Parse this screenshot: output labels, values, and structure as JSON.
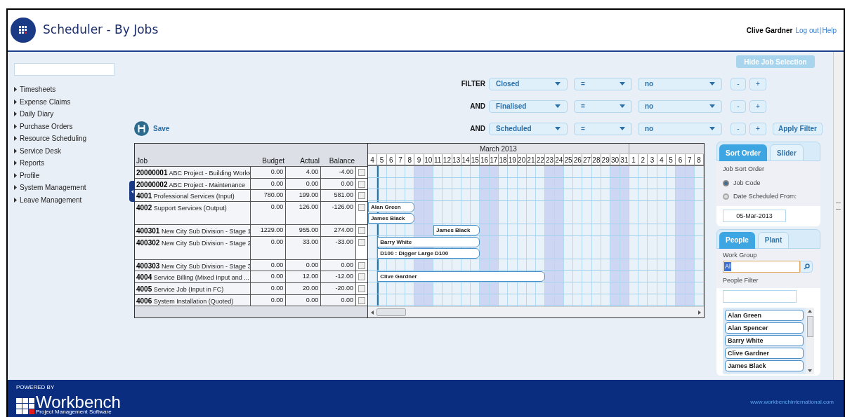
{
  "header": {
    "title": "Scheduler - By Jobs",
    "user": "Clive Gardner",
    "links": [
      "Log out",
      "Help"
    ],
    "link_separator": "|"
  },
  "sidebar": {
    "items": [
      "Timesheets",
      "Expense Claims",
      "Daily Diary",
      "Purchase Orders",
      "Resource Scheduling",
      "Service Desk",
      "Reports",
      "Profile",
      "System Management",
      "Leave Management"
    ]
  },
  "hide_button": "Hide Job Selection",
  "save_button": "Save",
  "filters": [
    {
      "conjunction": "FILTER",
      "field": "Closed",
      "operator": "=",
      "value": "no",
      "remove": "-",
      "add": "+"
    },
    {
      "conjunction": "AND",
      "field": "Finalised",
      "operator": "=",
      "value": "no",
      "remove": "-",
      "add": "+"
    },
    {
      "conjunction": "AND",
      "field": "Scheduled",
      "operator": "=",
      "value": "no",
      "remove": "-",
      "add": "+"
    }
  ],
  "apply_button": "Apply Filter",
  "table": {
    "columns": [
      "Job",
      "Budget",
      "Actual",
      "Balance"
    ],
    "rows": [
      {
        "code": "20000001",
        "name": "ABC Project - Building Works",
        "budget": "0.00",
        "actual": "4.00",
        "balance": "-4.00",
        "checked": false,
        "bars": []
      },
      {
        "code": "20000002",
        "name": "ABC Project - Maintenance",
        "budget": "0.00",
        "actual": "0.00",
        "balance": "0.00",
        "checked": false,
        "bars": []
      },
      {
        "code": "4001",
        "name": "Professional Services (Input)",
        "budget": "780.00",
        "actual": "199.00",
        "balance": "581.00",
        "checked": false,
        "bars": []
      },
      {
        "code": "4002",
        "name": "Support Services (Output)",
        "budget": "0.00",
        "actual": "126.00",
        "balance": "-126.00",
        "checked": false,
        "bars": [
          {
            "label": "Alan Green"
          },
          {
            "label": "James Black"
          }
        ]
      },
      {
        "code": "400301",
        "name": "New City Sub Division - Stage 1",
        "budget": "1229.00",
        "actual": "955.00",
        "balance": "274.00",
        "checked": false,
        "bars": [
          {
            "label": "James Black"
          }
        ]
      },
      {
        "code": "400302",
        "name": "New City Sub Division - Stage 2",
        "budget": "0.00",
        "actual": "33.00",
        "balance": "-33.00",
        "checked": false,
        "bars": [
          {
            "label": "Barry White"
          },
          {
            "label": "D100 : Digger Large D100"
          }
        ]
      },
      {
        "code": "400303",
        "name": "New City Sub Division - Stage 3",
        "budget": "0.00",
        "actual": "0.00",
        "balance": "0.00",
        "checked": false,
        "bars": []
      },
      {
        "code": "4004",
        "name": "Service Billing (Mixed Input and ...",
        "budget": "0.00",
        "actual": "12.00",
        "balance": "-12.00",
        "checked": false,
        "bars": [
          {
            "label": "Clive Gardner"
          }
        ]
      },
      {
        "code": "4005",
        "name": "Service Job (Input in FC)",
        "budget": "0.00",
        "actual": "20.00",
        "balance": "-20.00",
        "checked": false,
        "bars": []
      },
      {
        "code": "4006",
        "name": "System Installation (Quoted)",
        "budget": "0.00",
        "actual": "0.00",
        "balance": "0.00",
        "checked": false,
        "bars": []
      }
    ]
  },
  "gantt": {
    "month": "March 2013",
    "days": [
      {
        "label": "4",
        "weekend": false
      },
      {
        "label": "5",
        "weekend": false
      },
      {
        "label": "6",
        "weekend": false
      },
      {
        "label": "7",
        "weekend": false
      },
      {
        "label": "8",
        "weekend": false
      },
      {
        "label": "9",
        "weekend": true
      },
      {
        "label": "10",
        "weekend": true
      },
      {
        "label": "11",
        "weekend": false
      },
      {
        "label": "12",
        "weekend": false
      },
      {
        "label": "13",
        "weekend": false
      },
      {
        "label": "14",
        "weekend": false
      },
      {
        "label": "15",
        "weekend": false
      },
      {
        "label": "16",
        "weekend": true
      },
      {
        "label": "17",
        "weekend": true
      },
      {
        "label": "18",
        "weekend": false
      },
      {
        "label": "19",
        "weekend": false
      },
      {
        "label": "20",
        "weekend": false
      },
      {
        "label": "21",
        "weekend": false
      },
      {
        "label": "22",
        "weekend": false
      },
      {
        "label": "23",
        "weekend": true
      },
      {
        "label": "24",
        "weekend": true
      },
      {
        "label": "25",
        "weekend": false
      },
      {
        "label": "26",
        "weekend": false
      },
      {
        "label": "27",
        "weekend": false
      },
      {
        "label": "28",
        "weekend": false
      },
      {
        "label": "29",
        "weekend": false
      },
      {
        "label": "30",
        "weekend": true
      },
      {
        "label": "31",
        "weekend": true
      },
      {
        "label": "1",
        "weekend": false
      },
      {
        "label": "2",
        "weekend": false
      },
      {
        "label": "3",
        "weekend": false
      },
      {
        "label": "4",
        "weekend": false
      },
      {
        "label": "5",
        "weekend": false
      },
      {
        "label": "6",
        "weekend": true
      },
      {
        "label": "7",
        "weekend": true
      },
      {
        "label": "8",
        "weekend": false
      }
    ]
  },
  "sort_panel": {
    "tabs": [
      {
        "label": "Sort Order",
        "selected": true
      },
      {
        "label": "Slider",
        "selected": false
      }
    ],
    "heading": "Job Sort Order",
    "options": [
      {
        "label": "Job Code",
        "selected": true
      },
      {
        "label": "Date Scheduled From:",
        "selected": false
      }
    ],
    "date": "05-Mar-2013"
  },
  "people_panel": {
    "tabs": [
      {
        "label": "People",
        "selected": true
      },
      {
        "label": "Plant",
        "selected": false
      }
    ],
    "work_group_label": "Work Group",
    "work_group": "Al",
    "people_filter_label": "People Filter",
    "people": [
      "Alan Green",
      "Alan Spencer",
      "Barry White",
      "Clive Gardner",
      "James Black"
    ]
  },
  "footer": {
    "powered_by": "POWERED BY",
    "brand": "Workbench",
    "tagline": "Project Management Software",
    "url": "www.workbenchinternational.com"
  }
}
